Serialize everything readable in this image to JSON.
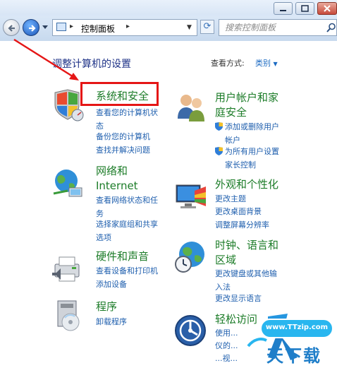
{
  "window": {
    "address_location": "控制面板",
    "search_placeholder": "搜索控制面板"
  },
  "content": {
    "title": "调整计算机的设置",
    "view_by_label": "查看方式:",
    "view_by_value": "类别"
  },
  "categories": {
    "system_security": {
      "title": "系统和安全",
      "links": [
        "查看您的计算机状",
        "态",
        "备份您的计算机",
        "查找并解决问题"
      ]
    },
    "user_accounts": {
      "title_line1": "用户帐户和家",
      "title_line2": "庭安全",
      "links": [
        "添加或删除用户",
        "帐户",
        "为所有用户设置",
        "家长控制"
      ]
    },
    "network": {
      "title_line1": "网络和",
      "title_line2": "Internet",
      "links": [
        "查看网络状态和任",
        "务",
        "选择家庭组和共享",
        "选项"
      ]
    },
    "appearance": {
      "title": "外观和个性化",
      "links": [
        "更改主题",
        "更改桌面背景",
        "调整屏幕分辨率"
      ]
    },
    "hardware": {
      "title": "硬件和声音",
      "links": [
        "查看设备和打印机",
        "添加设备"
      ]
    },
    "clock": {
      "title_line1": "时钟、语言和",
      "title_line2": "区域",
      "links": [
        "更改键盘或其他输",
        "入法",
        "更改显示语言"
      ]
    },
    "programs": {
      "title": "程序",
      "links": [
        "卸载程序"
      ]
    },
    "ease": {
      "title": "轻松访问",
      "links": [
        "使用...",
        "仪的...",
        "...视..."
      ]
    }
  },
  "watermark": {
    "url": "www.TTzip.com",
    "text": "天下载"
  },
  "colors": {
    "category_title": "#1c7c28",
    "link": "#1f5fae",
    "annotation_red": "#e51616",
    "page_title": "#1e3287"
  }
}
